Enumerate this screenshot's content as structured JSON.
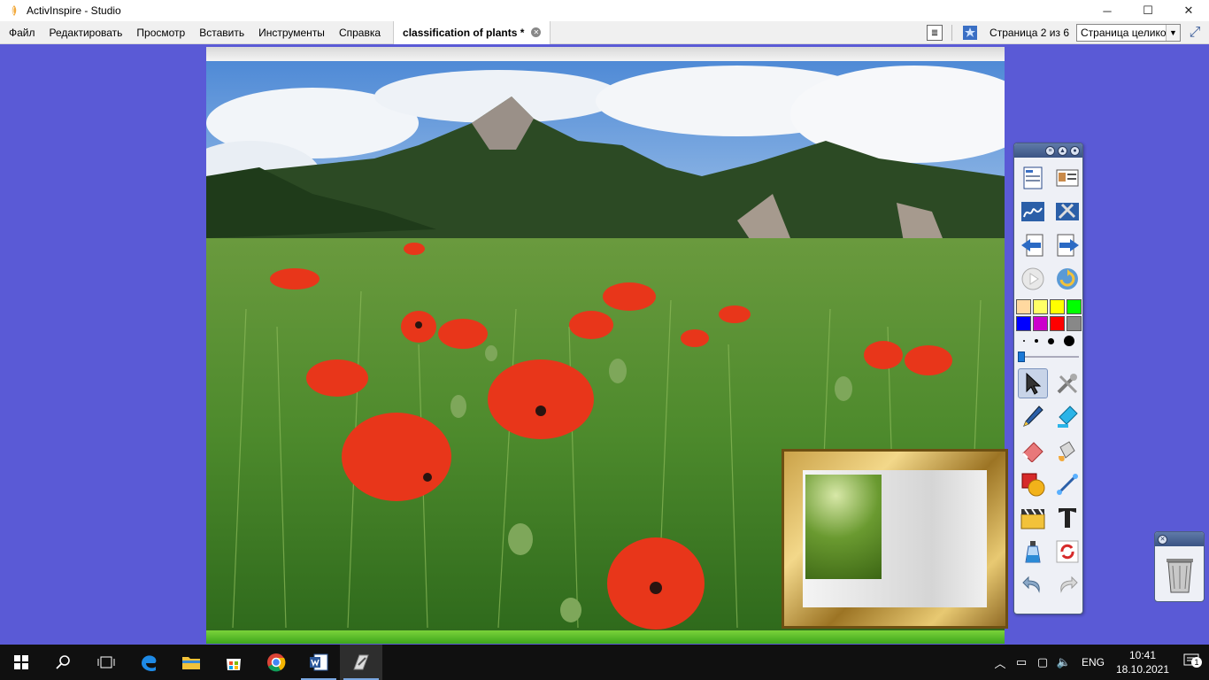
{
  "window": {
    "title": "ActivInspire - Studio",
    "controls": {
      "minimize": "─",
      "maximize": "☐",
      "close": "✕"
    }
  },
  "menu": {
    "items": [
      "Файл",
      "Редактировать",
      "Просмотр",
      "Вставить",
      "Инструменты",
      "Справка"
    ],
    "document_tab": "classification of plants *",
    "page_indicator": "Страница 2 из 6",
    "zoom_value": "Страница целиком"
  },
  "toolbox": {
    "palette": [
      "#ffd9a0",
      "#ffff66",
      "#ffff00",
      "#00ff00",
      "#0000ff",
      "#cc00cc",
      "#ff0000",
      "#888888"
    ],
    "selected_tool": "select-tool"
  },
  "taskbar": {
    "language": "ENG",
    "time": "10:41",
    "date": "18.10.2021",
    "notification_count": "1"
  }
}
